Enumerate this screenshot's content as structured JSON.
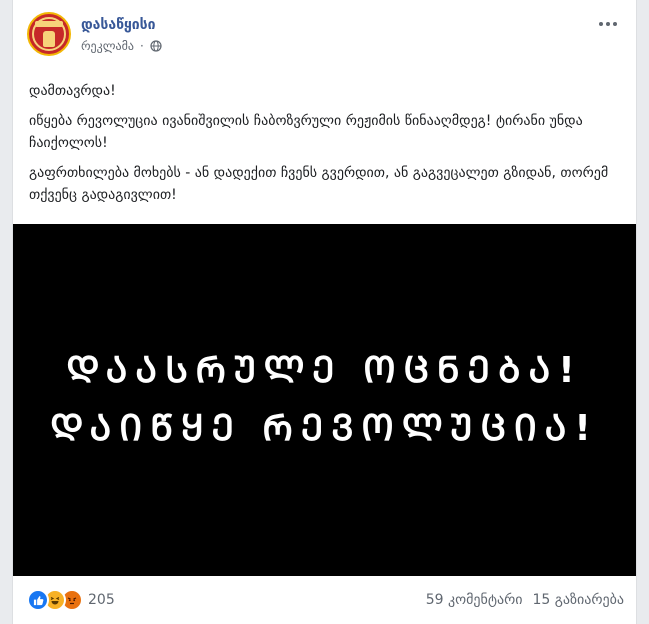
{
  "post": {
    "page_name": "დასაწყისი",
    "sponsored_label": "რეკლამა",
    "dot": "·",
    "more_label": "···",
    "paragraphs": [
      "დამთავრდა!",
      "იწყება რევოლუცია ივანიშვილის ჩაბოზვრული რეჟიმის წინააღმდეგ! ტირანი უნდა ჩაიქოლოს!",
      "გაფრთხილება მოხებს - ან დადექით ჩვენს გვერდით, ან გაგვეცალეთ გზიდან, თორემ თქვენც გადაგივლით!"
    ],
    "image_text": {
      "line1": "ᲓᲐᲐᲡᲠᲣᲚᲔ ᲝᲪᲜᲔᲑᲐ!",
      "line2": "ᲓᲐᲘᲬᲧᲔ ᲠᲔᲕᲝᲚᲣᲪᲘᲐ!"
    }
  },
  "footer": {
    "reaction_icons": [
      "like-icon",
      "haha-icon",
      "angry-icon"
    ],
    "reaction_count": "205",
    "comments": "59 კომენტარი",
    "shares": "15 გაზიარება"
  },
  "colors": {
    "page_name": "#385898",
    "like": "#1877f2",
    "haha": "#f7b125",
    "angry": "#e9710f",
    "image_bg": "#000000"
  }
}
